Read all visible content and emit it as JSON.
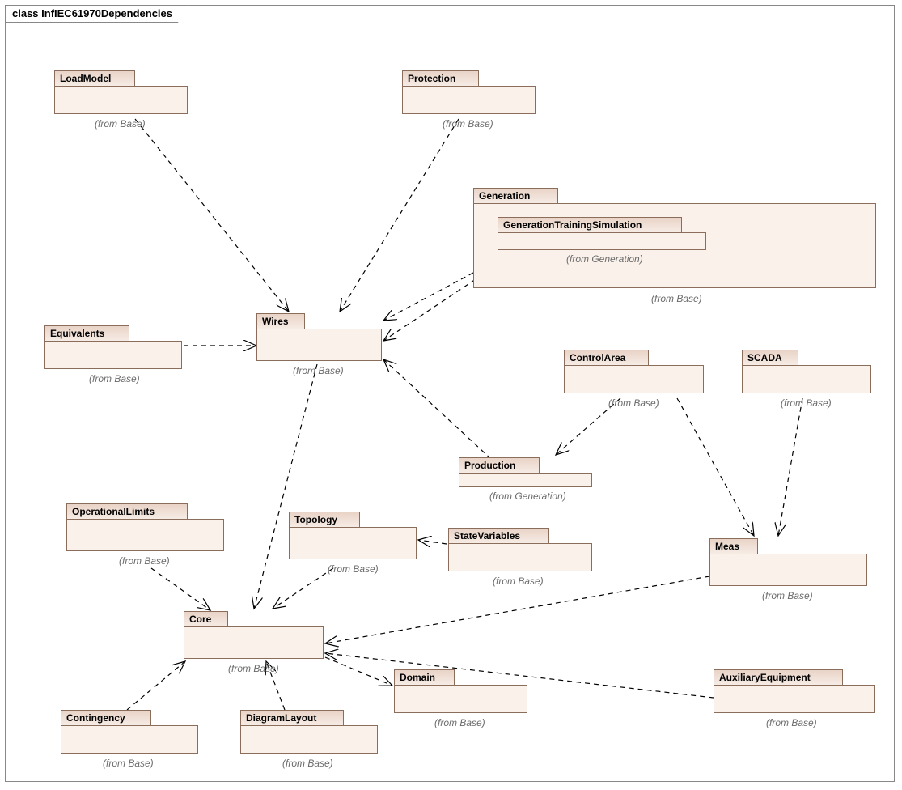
{
  "title": "class InfIEC61970Dependencies",
  "labels": {
    "fromBase": "(from Base)",
    "fromGeneration": "(from Generation)"
  },
  "packages": {
    "loadModel": {
      "name": "LoadModel"
    },
    "protection": {
      "name": "Protection"
    },
    "generation": {
      "name": "Generation"
    },
    "genTrainSim": {
      "name": "GenerationTrainingSimulation"
    },
    "wires": {
      "name": "Wires"
    },
    "equivalents": {
      "name": "Equivalents"
    },
    "controlArea": {
      "name": "ControlArea"
    },
    "scada": {
      "name": "SCADA"
    },
    "production": {
      "name": "Production"
    },
    "operationalLimits": {
      "name": "OperationalLimits"
    },
    "topology": {
      "name": "Topology"
    },
    "stateVariables": {
      "name": "StateVariables"
    },
    "meas": {
      "name": "Meas"
    },
    "core": {
      "name": "Core"
    },
    "domain": {
      "name": "Domain"
    },
    "auxEq": {
      "name": "AuxiliaryEquipment"
    },
    "contingency": {
      "name": "Contingency"
    },
    "diagramLayout": {
      "name": "DiagramLayout"
    }
  },
  "edges": [
    {
      "from": "loadModel",
      "to": "wires",
      "desc": "LoadModel→Wires"
    },
    {
      "from": "protection",
      "to": "wires",
      "desc": "Protection→Wires"
    },
    {
      "from": "generation",
      "to": "wires",
      "desc": "Generation→Wires"
    },
    {
      "from": "genTrainSim",
      "to": "wires",
      "desc": "GenerationTrainingSimulation→Wires"
    },
    {
      "from": "production",
      "to": "wires",
      "desc": "Production→Wires"
    },
    {
      "from": "equivalents",
      "to": "wires",
      "desc": "Equivalents→Wires"
    },
    {
      "from": "controlArea",
      "to": "production",
      "desc": "ControlArea→Production"
    },
    {
      "from": "controlArea",
      "to": "meas",
      "desc": "ControlArea→Meas"
    },
    {
      "from": "scada",
      "to": "meas",
      "desc": "SCADA→Meas"
    },
    {
      "from": "stateVariables",
      "to": "topology",
      "desc": "StateVariables→Topology"
    },
    {
      "from": "topology",
      "to": "core",
      "desc": "Topology→Core"
    },
    {
      "from": "wires",
      "to": "core",
      "desc": "Wires→Core"
    },
    {
      "from": "operationalLimits",
      "to": "core",
      "desc": "OperationalLimits→Core"
    },
    {
      "from": "meas",
      "to": "core",
      "desc": "Meas→Core"
    },
    {
      "from": "diagramLayout",
      "to": "core",
      "desc": "DiagramLayout→Core"
    },
    {
      "from": "contingency",
      "to": "core",
      "desc": "Contingency→Core"
    },
    {
      "from": "auxEq",
      "to": "core",
      "desc": "AuxiliaryEquipment→Core"
    },
    {
      "from": "core",
      "to": "domain",
      "desc": "Core→Domain"
    }
  ]
}
